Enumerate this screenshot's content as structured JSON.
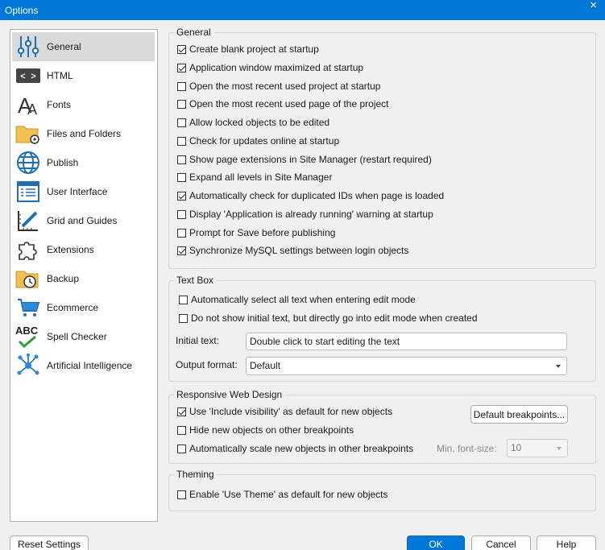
{
  "window": {
    "title": "Options",
    "close_glyph": "×"
  },
  "sidebar": {
    "items": [
      {
        "label": "General",
        "icon": "sliders-icon",
        "selected": true
      },
      {
        "label": "HTML",
        "icon": "html-code-icon"
      },
      {
        "label": "Fonts",
        "icon": "font-icon"
      },
      {
        "label": "Files and Folders",
        "icon": "folder-gear-icon"
      },
      {
        "label": "Publish",
        "icon": "globe-icon"
      },
      {
        "label": "User Interface",
        "icon": "window-ui-icon"
      },
      {
        "label": "Grid and Guides",
        "icon": "ruler-pencil-icon"
      },
      {
        "label": "Extensions",
        "icon": "puzzle-icon"
      },
      {
        "label": "Backup",
        "icon": "backup-folder-clock-icon"
      },
      {
        "label": "Ecommerce",
        "icon": "cart-icon"
      },
      {
        "label": "Spell Checker",
        "icon": "abc-check-icon"
      },
      {
        "label": "Artificial Intelligence",
        "icon": "network-nodes-icon"
      }
    ]
  },
  "general": {
    "legend": "General",
    "options": [
      {
        "label": "Create blank project at startup",
        "checked": true
      },
      {
        "label": "Application window maximized at startup",
        "checked": true
      },
      {
        "label": "Open the most recent used project at startup",
        "checked": false
      },
      {
        "label": "Open the most recent used page of the project",
        "checked": false
      },
      {
        "label": "Allow locked objects to be edited",
        "checked": false
      },
      {
        "label": "Check for updates online at startup",
        "checked": false
      },
      {
        "label": "Show page extensions in Site Manager (restart required)",
        "checked": false
      },
      {
        "label": "Expand all levels in Site Manager",
        "checked": false
      },
      {
        "label": "Automatically check for duplicated IDs when page is loaded",
        "checked": true
      },
      {
        "label": "Display 'Application is already running' warning at startup",
        "checked": false
      },
      {
        "label": "Prompt for Save before publishing",
        "checked": false
      },
      {
        "label": "Synchronize MySQL settings between login objects",
        "checked": true
      }
    ]
  },
  "textbox": {
    "legend": "Text Box",
    "options": [
      {
        "label": "Automatically select all text when entering edit mode",
        "checked": false
      },
      {
        "label": "Do not show initial text, but directly go into edit mode when created",
        "checked": false
      }
    ],
    "initial_text_label": "Initial text:",
    "initial_text_value": "Double click to start editing the text",
    "output_format_label": "Output format:",
    "output_format_value": "Default"
  },
  "responsive": {
    "legend": "Responsive Web Design",
    "options": [
      {
        "label": "Use 'Include visibility' as default for new objects",
        "checked": true
      },
      {
        "label": "Hide new objects on other breakpoints",
        "checked": false
      },
      {
        "label": "Automatically scale new objects in other breakpoints",
        "checked": false
      }
    ],
    "breakpoints_button": "Default breakpoints...",
    "min_font_label": "Min. font-size:",
    "min_font_value": "10"
  },
  "theming": {
    "legend": "Theming",
    "options": [
      {
        "label": "Enable 'Use Theme' as default for new objects",
        "checked": false
      }
    ]
  },
  "footer": {
    "reset": "Reset Settings",
    "ok": "OK",
    "cancel": "Cancel",
    "help": "Help"
  },
  "colors": {
    "accent": "#0078d7",
    "selection": "#dadada",
    "icon_blue": "#1f6fb2"
  }
}
